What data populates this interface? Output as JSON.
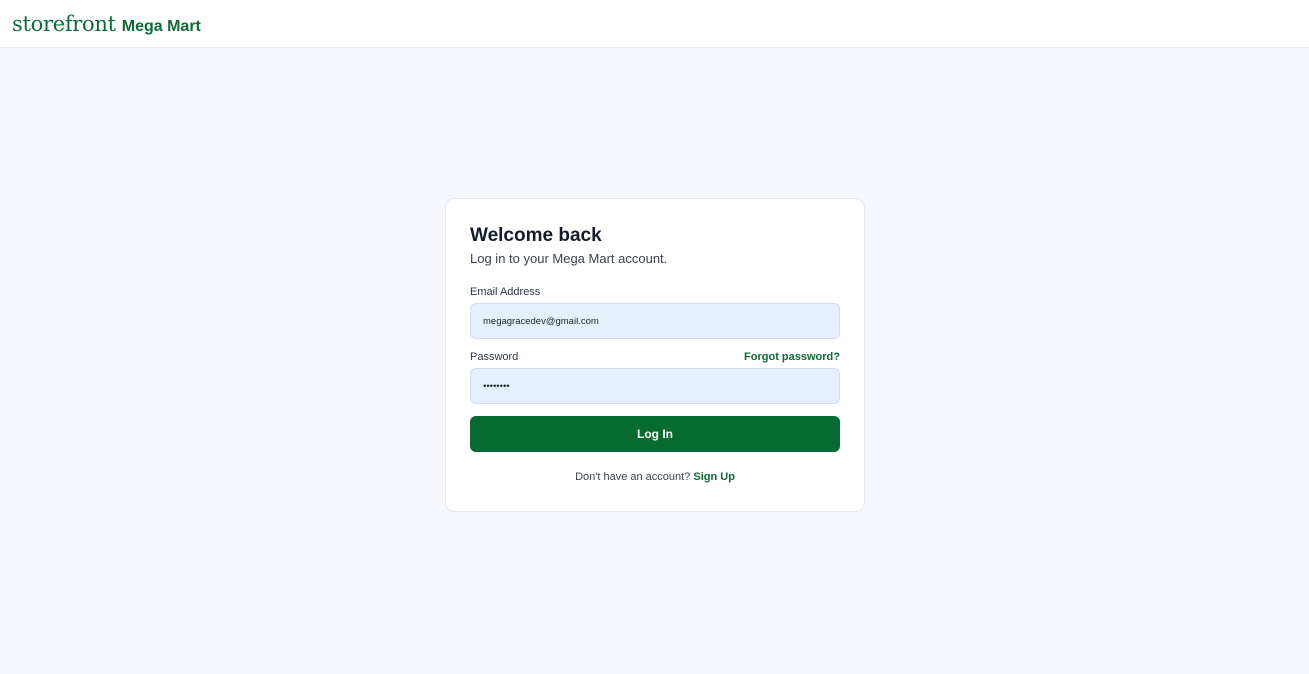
{
  "header": {
    "brand_word": "storefront",
    "brand_name": "Mega Mart"
  },
  "login": {
    "title": "Welcome back",
    "subtitle": "Log in to your Mega Mart account.",
    "email_label": "Email Address",
    "email_value": "megagracedev@gmail.com",
    "password_label": "Password",
    "password_value": "••••••••",
    "forgot_label": "Forgot password?",
    "submit_label": "Log In",
    "signup_prompt": "Don't have an account?",
    "signup_label": "Sign Up"
  },
  "colors": {
    "brand": "#0d6b34",
    "button": "#066b2e",
    "page_bg": "#f5f7fc",
    "input_bg": "#e8effc"
  }
}
